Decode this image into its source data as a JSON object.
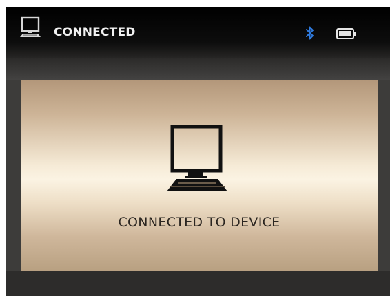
{
  "status_bar": {
    "title": "CONNECTED",
    "left_icon": "computer-icon",
    "bluetooth_icon": "bluetooth-icon",
    "battery_icon": "battery-icon",
    "bluetooth_color": "#2f7be0"
  },
  "main_panel": {
    "icon": "computer-monitor-icon",
    "message": "CONNECTED TO DEVICE"
  }
}
